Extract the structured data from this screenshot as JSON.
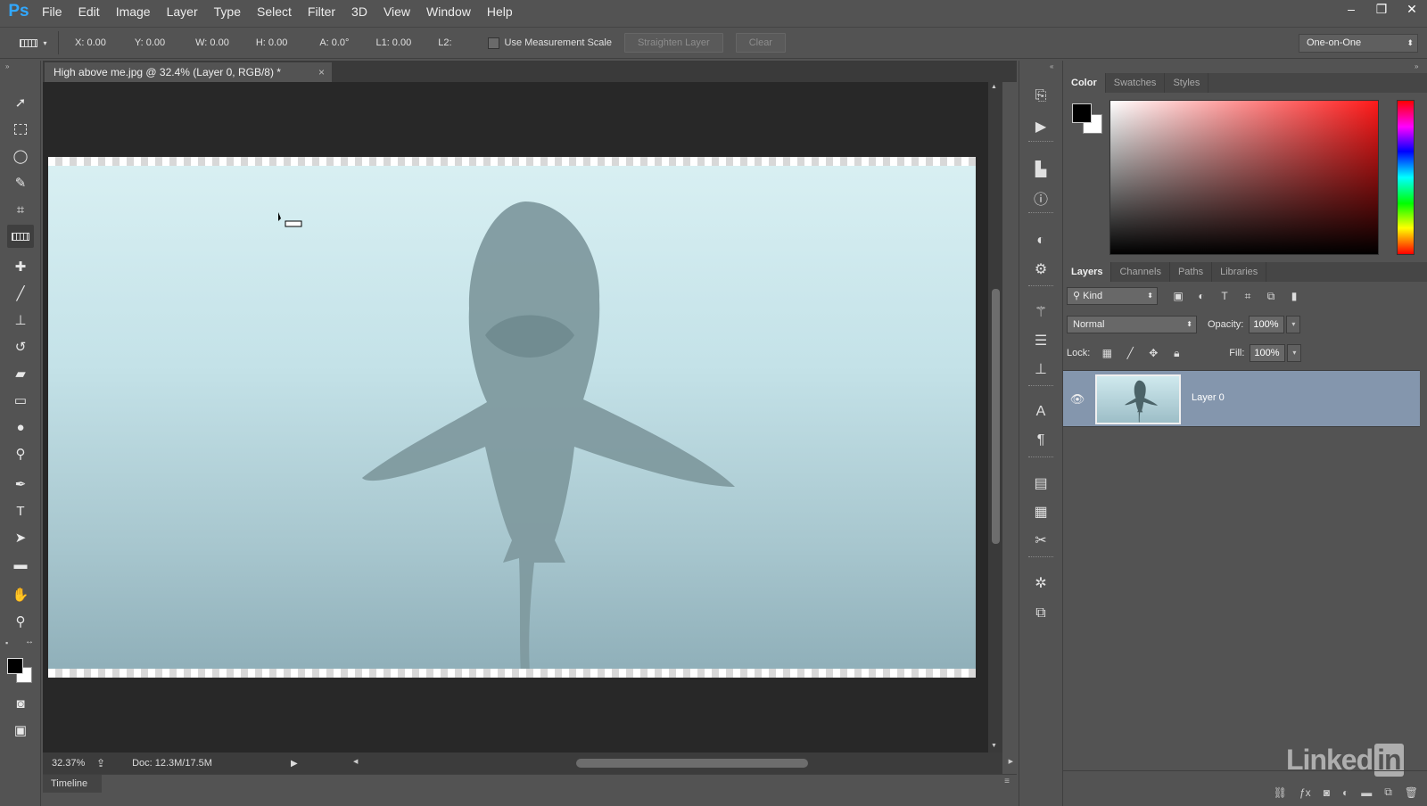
{
  "app": {
    "logo": "Ps",
    "menu": [
      "File",
      "Edit",
      "Image",
      "Layer",
      "Type",
      "Select",
      "Filter",
      "3D",
      "View",
      "Window",
      "Help"
    ],
    "window_controls": [
      "–",
      "❐",
      "✕"
    ]
  },
  "options_bar": {
    "x": "X: 0.00",
    "y": "Y: 0.00",
    "w": "W: 0.00",
    "h": "H: 0.00",
    "a": "A: 0.0°",
    "l1": "L1: 0.00",
    "l2": "L2:",
    "measurement_scale_label": "Use Measurement Scale",
    "straighten_label": "Straighten Layer",
    "clear_label": "Clear",
    "workspace": "One-on-One"
  },
  "document": {
    "tab_title": "High above me.jpg @ 32.4% (Layer 0, RGB/8) *",
    "close_glyph": "×",
    "zoom": "32.37%",
    "doc_size": "Doc: 12.3M/17.5M",
    "timeline_label": "Timeline"
  },
  "color_panel": {
    "tabs": [
      "Color",
      "Swatches",
      "Styles"
    ],
    "foreground": "#000000",
    "background": "#ffffff"
  },
  "layers_panel": {
    "tabs": [
      "Layers",
      "Channels",
      "Paths",
      "Libraries"
    ],
    "filter_kind": "Kind",
    "blend_mode": "Normal",
    "opacity_label": "Opacity:",
    "opacity_value": "100%",
    "lock_label": "Lock:",
    "fill_label": "Fill:",
    "fill_value": "100%",
    "layers": [
      {
        "name": "Layer 0",
        "visible": true,
        "selected": true
      }
    ]
  },
  "watermark": {
    "text": "Linked",
    "badge": "in"
  },
  "colors": {
    "ui_gray": "#535353",
    "dark_gray": "#282828",
    "selected_layer": "#8496ad",
    "accent_blue": "#31a8ff"
  }
}
